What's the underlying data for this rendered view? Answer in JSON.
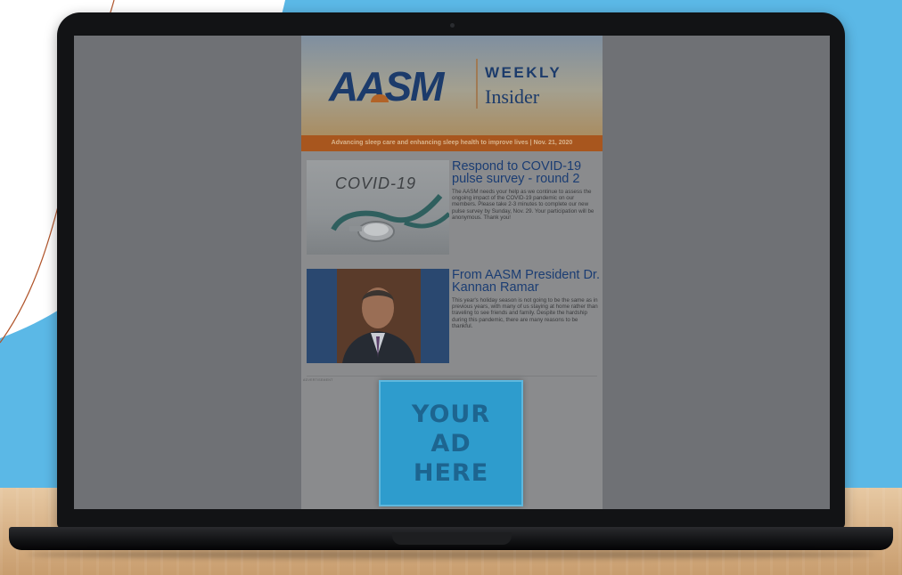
{
  "newsletter": {
    "logo": "AASM",
    "brand_top": "WEEKLY",
    "brand_bottom": "Insider",
    "tagline": "Advancing sleep care and enhancing sleep health to improve lives  |  Nov. 21, 2020",
    "articles": [
      {
        "thumb_label": "COVID-19",
        "title": "Respond to COVID-19 pulse survey - round 2",
        "body": "The AASM needs your help as we continue to assess the ongoing impact of the COVID-19 pandemic on our members. Please take 2-3 minutes to complete our new pulse survey by Sunday, Nov. 29. Your participation will be anonymous. Thank you!"
      },
      {
        "thumb_label": "",
        "title": "From AASM President Dr. Kannan Ramar",
        "body": "This year's holiday season is not going to be the same as in previous years, with many of us staying at home rather than traveling to see friends and family. Despite the hardship during this pandemic, there are many reasons to be thankful."
      }
    ],
    "ad_label": "ADVERTISEMENT",
    "ad_lines": [
      "YOUR",
      "AD",
      "HERE"
    ]
  },
  "colors": {
    "sky": "#5bb8e6",
    "desk": "#dcb88d",
    "laptop": "#121315",
    "brand_blue": "#1c3b6b",
    "tagline_orange": "#a8561e",
    "ad_blue": "#2e9ccd"
  }
}
